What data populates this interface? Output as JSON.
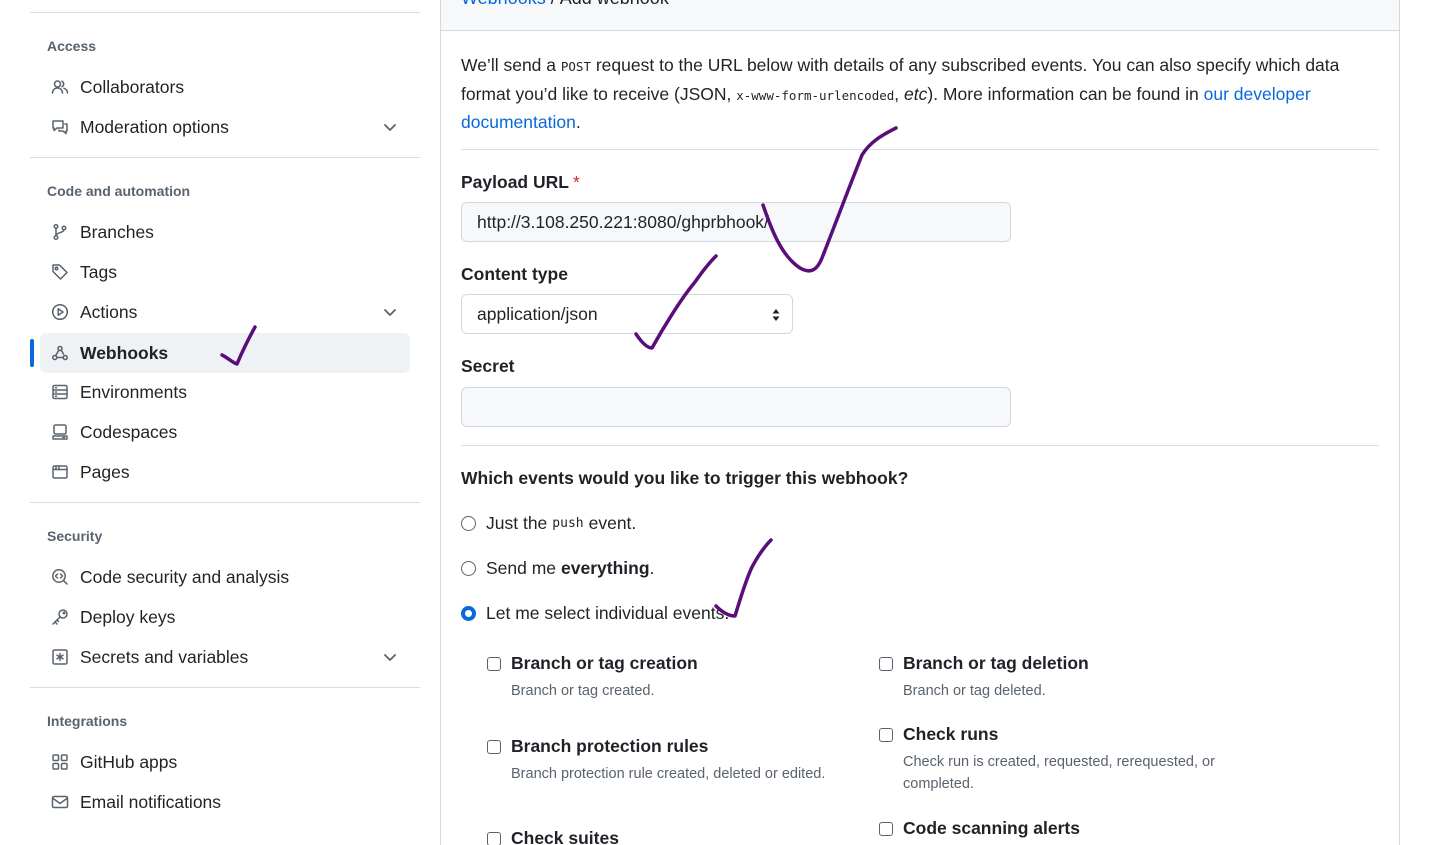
{
  "sidebar": {
    "sections": [
      {
        "heading": "Access",
        "items": [
          {
            "label": "Collaborators",
            "icon": "people-icon",
            "expandable": false
          },
          {
            "label": "Moderation options",
            "icon": "comment-discussion-icon",
            "expandable": true
          }
        ]
      },
      {
        "heading": "Code and automation",
        "items": [
          {
            "label": "Branches",
            "icon": "git-branch-icon",
            "expandable": false
          },
          {
            "label": "Tags",
            "icon": "tag-icon",
            "expandable": false
          },
          {
            "label": "Actions",
            "icon": "play-icon",
            "expandable": true
          },
          {
            "label": "Webhooks",
            "icon": "webhook-icon",
            "expandable": false,
            "active": true
          },
          {
            "label": "Environments",
            "icon": "server-icon",
            "expandable": false
          },
          {
            "label": "Codespaces",
            "icon": "codespaces-icon",
            "expandable": false
          },
          {
            "label": "Pages",
            "icon": "browser-icon",
            "expandable": false
          }
        ]
      },
      {
        "heading": "Security",
        "items": [
          {
            "label": "Code security and analysis",
            "icon": "codescan-icon",
            "expandable": false
          },
          {
            "label": "Deploy keys",
            "icon": "key-icon",
            "expandable": false
          },
          {
            "label": "Secrets and variables",
            "icon": "key-asterisk-icon",
            "expandable": true
          }
        ]
      },
      {
        "heading": "Integrations",
        "items": [
          {
            "label": "GitHub apps",
            "icon": "apps-icon",
            "expandable": false
          },
          {
            "label": "Email notifications",
            "icon": "mail-icon",
            "expandable": false
          }
        ]
      }
    ]
  },
  "main": {
    "breadcrumb": {
      "link": "Webhooks",
      "separator": " / ",
      "current": "Add webhook"
    },
    "intro": {
      "p1": "We’ll send a ",
      "code1": "POST",
      "p2": " request to the URL below with details of any subscribed events. You can also specify which data format you’d like to receive (JSON, ",
      "code2": "x-www-form-urlencoded",
      "p3": ", ",
      "em": "etc",
      "p4": "). More information can be found in ",
      "link": "our developer documentation",
      "p5": "."
    },
    "payload_url": {
      "label": "Payload URL",
      "required_mark": "*",
      "value": "http://3.108.250.221:8080/ghprbhook/"
    },
    "content_type": {
      "label": "Content type",
      "selected": "application/json"
    },
    "secret": {
      "label": "Secret",
      "value": ""
    },
    "events": {
      "question": "Which events would you like to trigger this webhook?",
      "push": {
        "pre": "Just the",
        "code": "push",
        "post": "event."
      },
      "everything": {
        "pre": "Send me",
        "bold": "everything",
        "post": "."
      },
      "individual": {
        "label": "Let me select individual events."
      },
      "selected_option": "individual",
      "list": [
        {
          "title": "Branch or tag creation",
          "desc": "Branch or tag created."
        },
        {
          "title": "Branch or tag deletion",
          "desc": "Branch or tag deleted."
        },
        {
          "title": "Branch protection rules",
          "desc": "Branch protection rule created, deleted or edited."
        },
        {
          "title": "Check runs",
          "desc": "Check run is created, requested, rerequested, or completed."
        },
        {
          "title": "Check suites",
          "desc": ""
        },
        {
          "title": "Code scanning alerts",
          "desc": ""
        }
      ]
    }
  },
  "colors": {
    "accent": "#0969da",
    "ink": "#5a0e7a",
    "required": "#d1242f"
  }
}
